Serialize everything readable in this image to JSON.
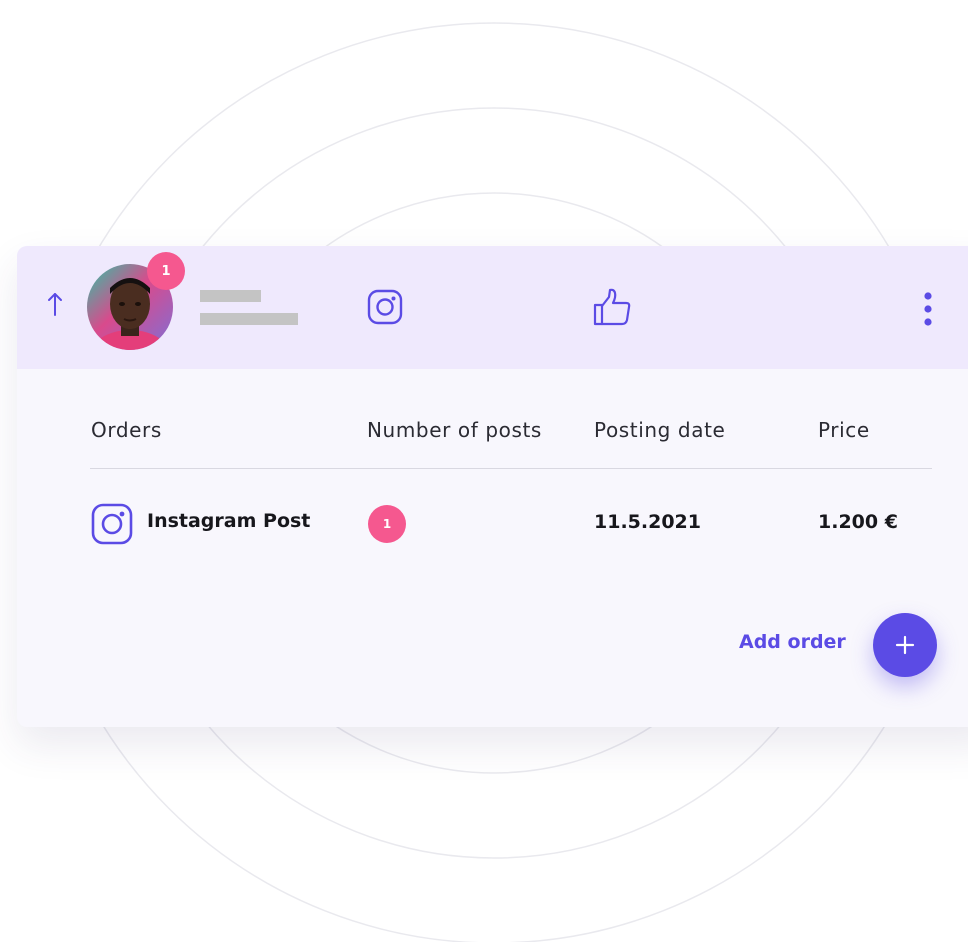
{
  "header": {
    "notification_count": "1",
    "colors": {
      "header_bg": "#efe9fd",
      "accent": "#5b4be5",
      "badge": "#f5588f"
    },
    "icons": [
      "arrow-up-icon",
      "instagram-icon",
      "thumbs-up-icon",
      "more-vertical-icon"
    ]
  },
  "table": {
    "columns": [
      "Orders",
      "Number of posts",
      "Posting date",
      "Price"
    ],
    "rows": [
      {
        "icon": "instagram-icon",
        "order": "Instagram Post",
        "posts": "1",
        "date": "11.5.2021",
        "price": "1.200 €"
      }
    ]
  },
  "actions": {
    "add_order_label": "Add order",
    "add_icon": "plus-icon"
  }
}
